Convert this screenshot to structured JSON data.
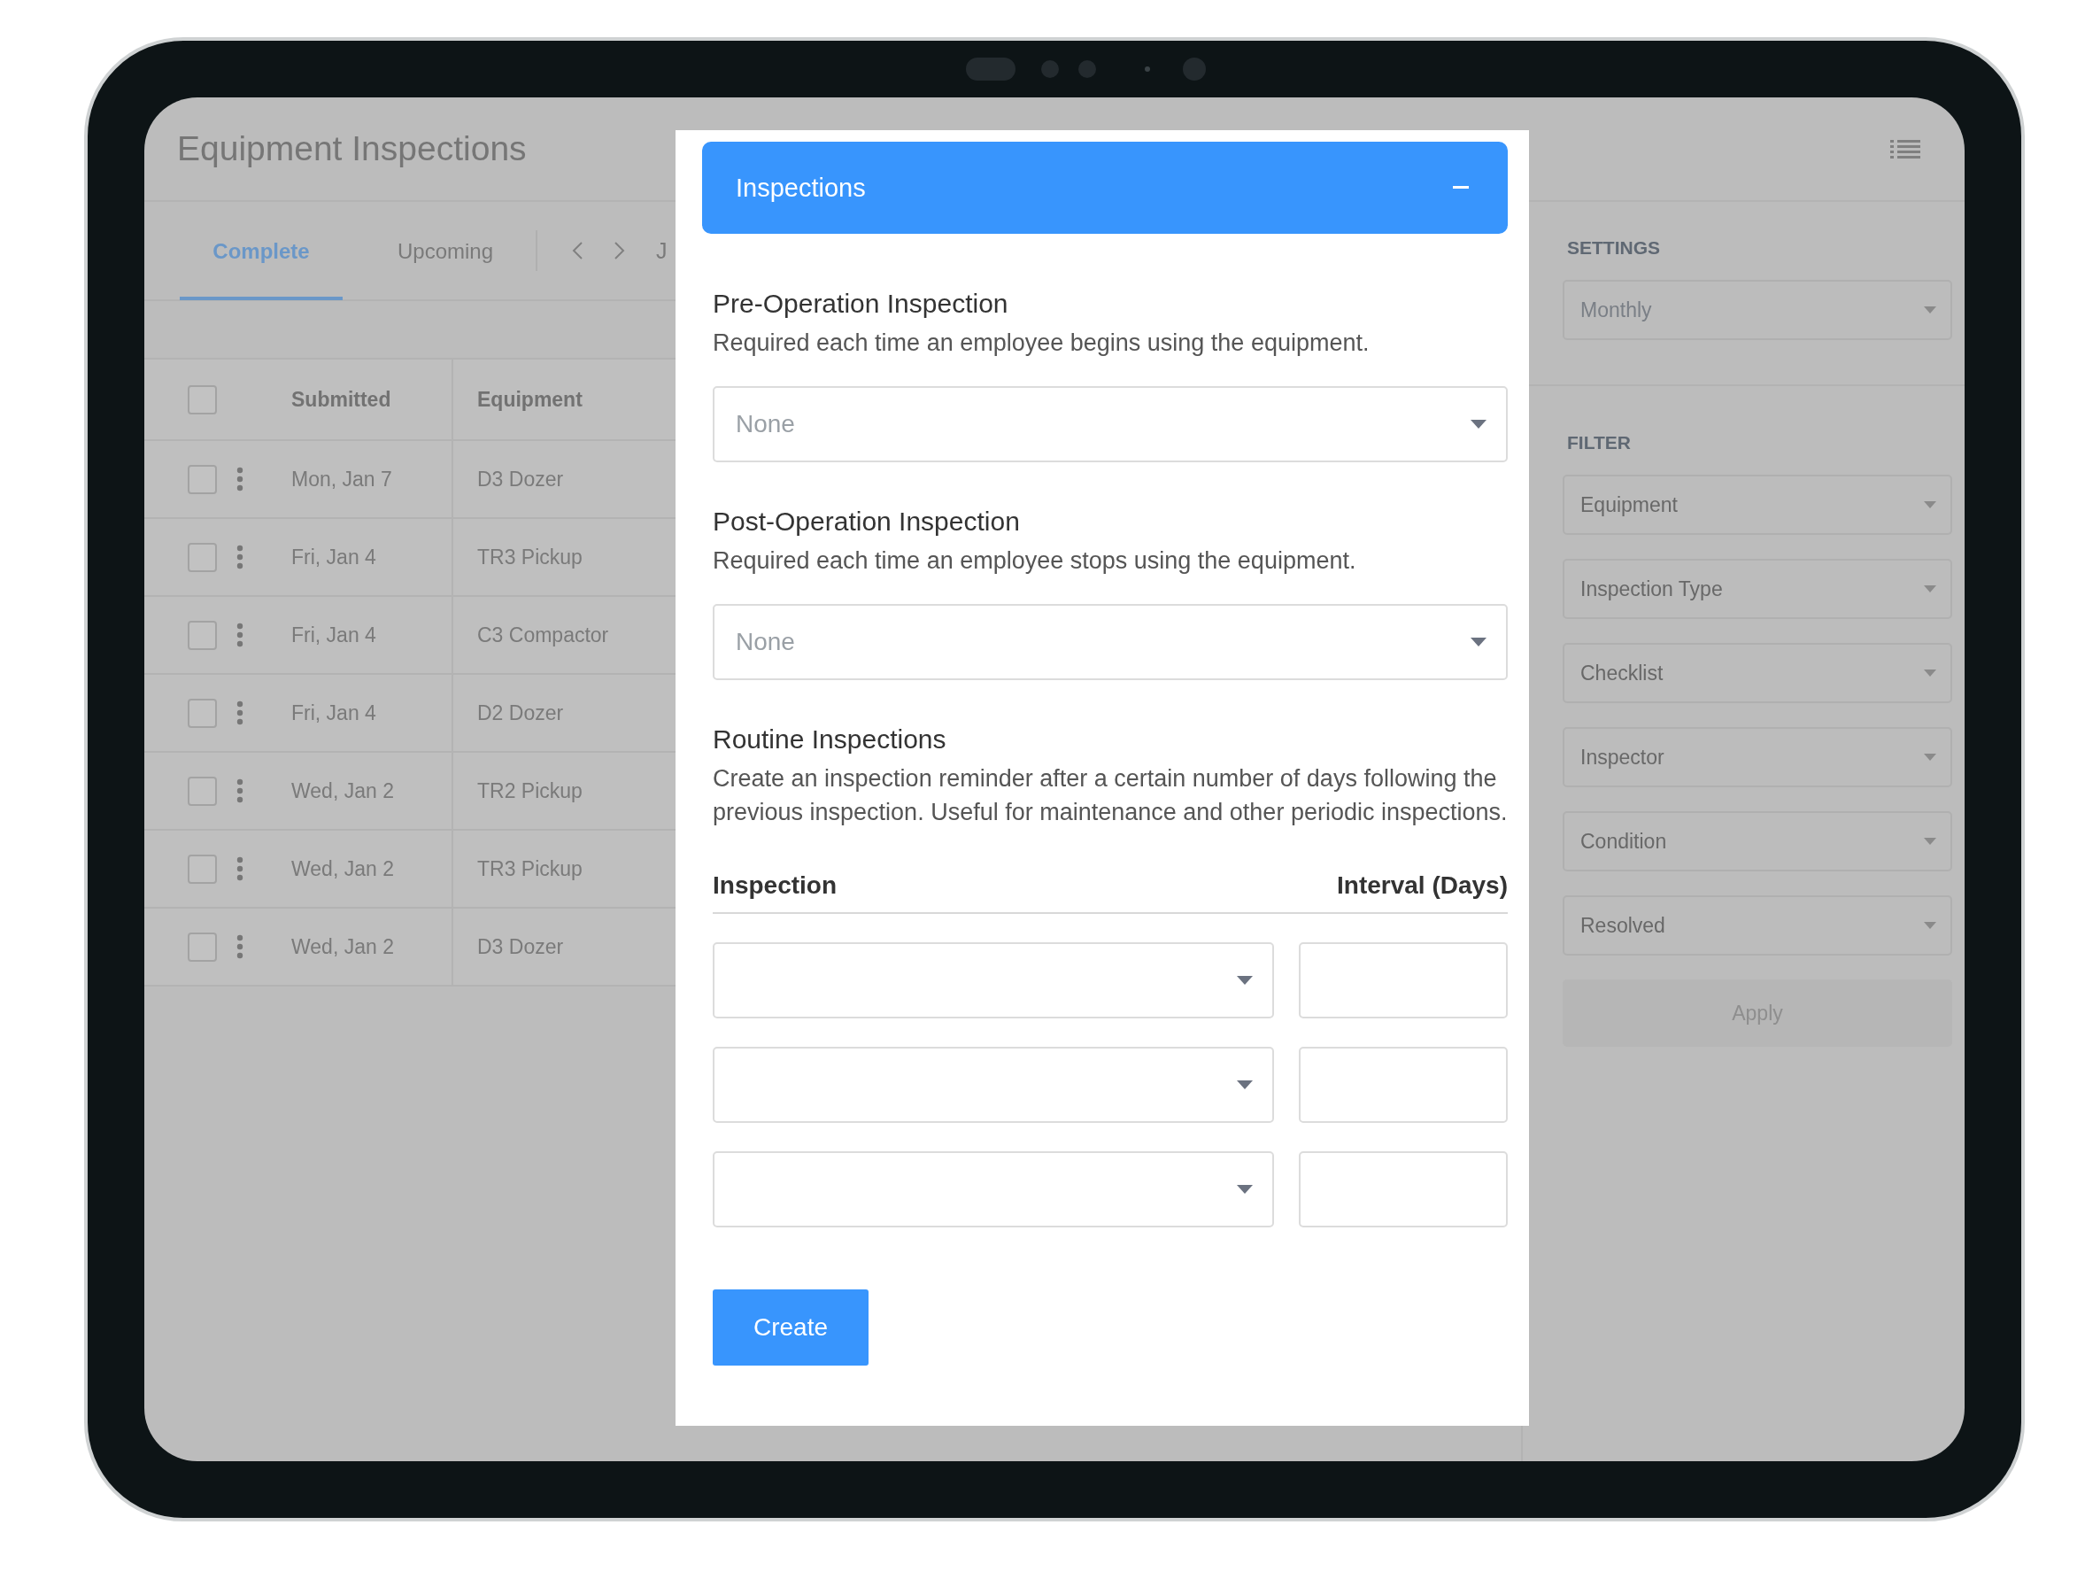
{
  "app": {
    "title": "Equipment Inspections"
  },
  "tabs": [
    {
      "label": "Complete",
      "selected": true
    },
    {
      "label": "Upcoming",
      "selected": false
    }
  ],
  "date_nav": {
    "label": "J"
  },
  "table": {
    "columns": [
      "Submitted",
      "Equipment"
    ],
    "header_checked": false,
    "rows": [
      {
        "submitted": "Mon, Jan 7",
        "equipment": "D3 Dozer",
        "checked": false
      },
      {
        "submitted": "Fri, Jan 4",
        "equipment": "TR3 Pickup",
        "checked": false
      },
      {
        "submitted": "Fri, Jan 4",
        "equipment": "C3 Compactor",
        "checked": false
      },
      {
        "submitted": "Fri, Jan 4",
        "equipment": "D2 Dozer",
        "checked": false
      },
      {
        "submitted": "Wed, Jan 2",
        "equipment": "TR2 Pickup",
        "checked": false
      },
      {
        "submitted": "Wed, Jan 2",
        "equipment": "TR3 Pickup",
        "checked": false
      },
      {
        "submitted": "Wed, Jan 2",
        "equipment": "D3 Dozer",
        "checked": false
      }
    ]
  },
  "sidebar": {
    "settings": {
      "heading": "SETTINGS",
      "select": {
        "value": "Monthly"
      }
    },
    "filter": {
      "heading": "FILTER",
      "selects": [
        {
          "placeholder": "Equipment"
        },
        {
          "placeholder": "Inspection Type"
        },
        {
          "placeholder": "Checklist"
        },
        {
          "placeholder": "Inspector"
        },
        {
          "placeholder": "Condition"
        },
        {
          "placeholder": "Resolved"
        }
      ],
      "apply": "Apply"
    }
  },
  "modal": {
    "header": {
      "title": "Inspections",
      "expanded": true
    },
    "pre_operation": {
      "title": "Pre-Operation Inspection",
      "description": "Required each time an employee begins using the equipment.",
      "select": {
        "placeholder": "None"
      }
    },
    "post_operation": {
      "title": "Post-Operation Inspection",
      "description": "Required each time an employee stops using the equipment.",
      "select": {
        "placeholder": "None"
      }
    },
    "routine": {
      "title": "Routine Inspections",
      "description": "Create an inspection reminder after a certain number of days following the previous inspection. Useful for maintenance and other periodic inspections.",
      "columns": [
        "Inspection",
        "Interval (Days)"
      ],
      "rows": [
        {
          "kind": "blank"
        },
        {
          "kind": "blank"
        },
        {
          "kind": "blank"
        }
      ]
    },
    "submit": "Create"
  }
}
